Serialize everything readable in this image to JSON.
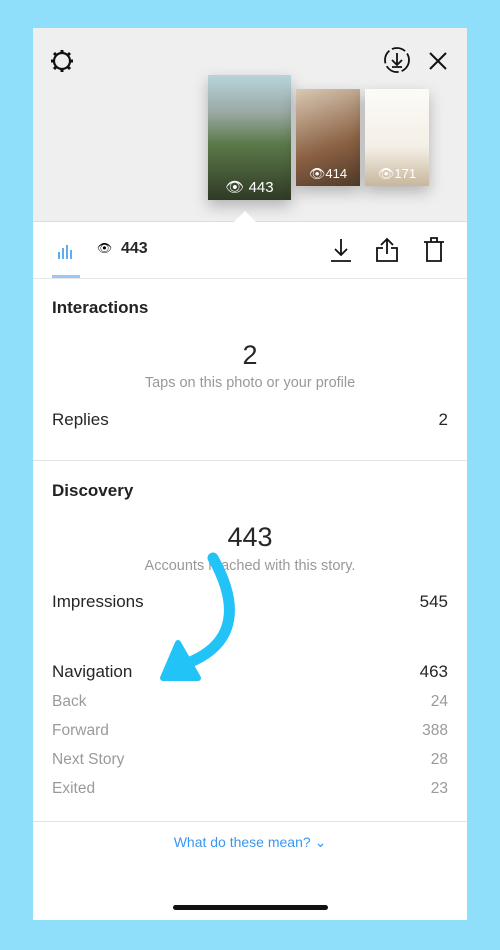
{
  "stories": [
    {
      "views": "443"
    },
    {
      "views": "414"
    },
    {
      "views": "171"
    }
  ],
  "toolbar": {
    "views": "443"
  },
  "interactions": {
    "title": "Interactions",
    "count": "2",
    "description": "Taps on this photo or your profile",
    "rows": [
      {
        "label": "Replies",
        "value": "2"
      }
    ]
  },
  "discovery": {
    "title": "Discovery",
    "count": "443",
    "description": "Accounts reached with this story.",
    "impressions": {
      "label": "Impressions",
      "value": "545"
    },
    "navigation": {
      "label": "Navigation",
      "value": "463"
    },
    "nav_rows": [
      {
        "label": "Back",
        "value": "24"
      },
      {
        "label": "Forward",
        "value": "388"
      },
      {
        "label": "Next Story",
        "value": "28"
      },
      {
        "label": "Exited",
        "value": "23"
      }
    ]
  },
  "footer": {
    "link": "What do these mean?"
  },
  "colors": {
    "background": "#8fdffb",
    "accent": "#3897f0",
    "arrow": "#22c3f7"
  }
}
